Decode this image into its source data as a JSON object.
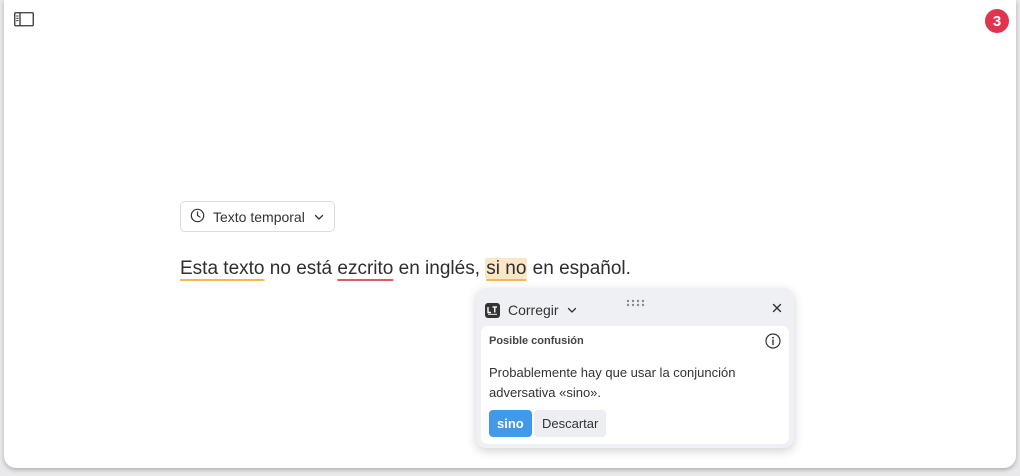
{
  "toolbar": {
    "sidebar_icon": "sidebar-panel-icon",
    "badge_count": "3",
    "badge_color": "#e0344f"
  },
  "editor": {
    "mode_dropdown": {
      "icon": "clock-icon",
      "label": "Texto temporal",
      "chevron": "chevron-down-icon"
    },
    "text_segments": [
      {
        "text": "Esta texto",
        "type": "style-issue"
      },
      {
        "text": " no está ",
        "type": "plain"
      },
      {
        "text": "ezcrito",
        "type": "spelling-issue"
      },
      {
        "text": " en inglés, ",
        "type": "plain"
      },
      {
        "text": "si no",
        "type": "active-issue"
      },
      {
        "text": " en español.",
        "type": "plain"
      }
    ]
  },
  "suggestion_popup": {
    "header_label": "Corregir",
    "logo_icon": "languagetool-logo-icon",
    "category": "Posible confusión",
    "message": "Probablemente hay que usar la conjunción adversativa «sino».",
    "primary_suggestion": "sino",
    "dismiss_label": "Descartar",
    "accent_color": "#4299e8"
  }
}
